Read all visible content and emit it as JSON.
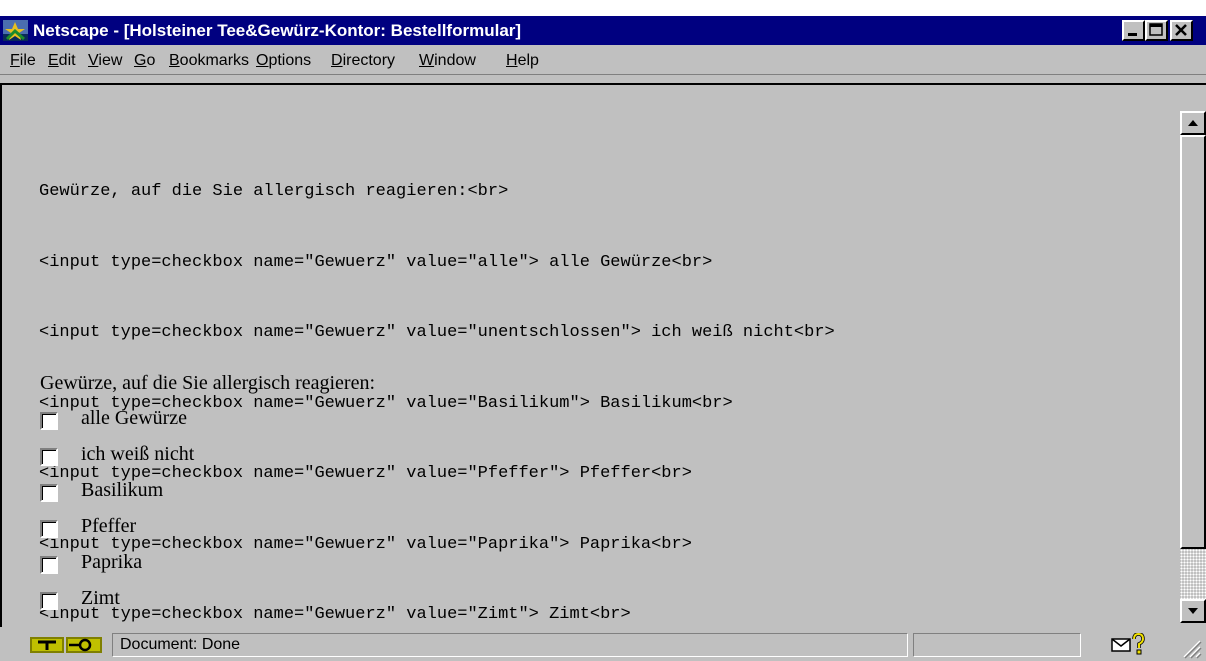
{
  "window": {
    "title": "Netscape - [Holsteiner Tee&Gewürz-Kontor: Bestellformular]"
  },
  "menu": [
    {
      "accel": "F",
      "rest": "ile"
    },
    {
      "accel": "E",
      "rest": "dit"
    },
    {
      "accel": "V",
      "rest": "iew"
    },
    {
      "accel": "G",
      "rest": "o"
    },
    {
      "accel": "B",
      "rest": "ookmarks"
    },
    {
      "accel": "O",
      "rest": "ptions"
    },
    {
      "accel": "D",
      "rest": "irectory"
    },
    {
      "accel": "W",
      "rest": "indow"
    },
    {
      "accel": "H",
      "rest": "elp"
    }
  ],
  "source_code": [
    "Gewürze, auf die Sie allergisch reagieren:<br>",
    "<input type=checkbox name=\"Gewuerz\" value=\"alle\"> alle Gewürze<br>",
    "<input type=checkbox name=\"Gewuerz\" value=\"unentschlossen\"> ich weiß nicht<br>",
    "<input type=checkbox name=\"Gewuerz\" value=\"Basilikum\"> Basilikum<br>",
    "<input type=checkbox name=\"Gewuerz\" value=\"Pfeffer\"> Pfeffer<br>",
    "<input type=checkbox name=\"Gewuerz\" value=\"Paprika\"> Paprika<br>",
    "<input type=checkbox name=\"Gewuerz\" value=\"Zimt\"> Zimt<br>"
  ],
  "form": {
    "title": "Gewürze, auf die Sie allergisch reagieren:",
    "options": [
      {
        "label": "alle Gewürze",
        "checked": false
      },
      {
        "label": "ich weiß nicht",
        "checked": false
      },
      {
        "label": "Basilikum",
        "checked": false
      },
      {
        "label": "Pfeffer",
        "checked": false
      },
      {
        "label": "Paprika",
        "checked": false
      },
      {
        "label": "Zimt",
        "checked": false
      }
    ]
  },
  "status": {
    "text": "Document: Done"
  },
  "icons": {
    "app": "netscape-logo-icon",
    "security": "security-key-icon",
    "mail": "mail-icon",
    "help": "help-icon"
  },
  "colors": {
    "titlebar": "#000080",
    "face": "#c0c0c0"
  }
}
